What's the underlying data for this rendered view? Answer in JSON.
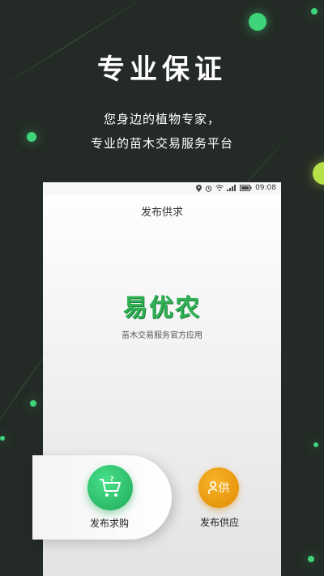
{
  "promo": {
    "headline": "专业保证",
    "line1": "您身边的植物专家，",
    "line2": "专业的苗木交易服务平台"
  },
  "status_bar": {
    "time": "09:08",
    "icons": [
      "location-icon",
      "alarm-icon",
      "wifi-icon",
      "signal-icon",
      "battery-icon"
    ]
  },
  "screen": {
    "title": "发布供求",
    "logo": "易优农",
    "logo_sub": "苗木交易服务官方应用"
  },
  "actions": {
    "buy_label": "发布求购",
    "buy_icon": "shopping-cart-question-icon",
    "supply_label": "发布供应",
    "supply_icon_text": "供",
    "supply_icon": "person-supply-icon"
  },
  "colors": {
    "background": "#242a26",
    "accent_green": "#2fb154",
    "accent_orange": "#e08a00"
  }
}
